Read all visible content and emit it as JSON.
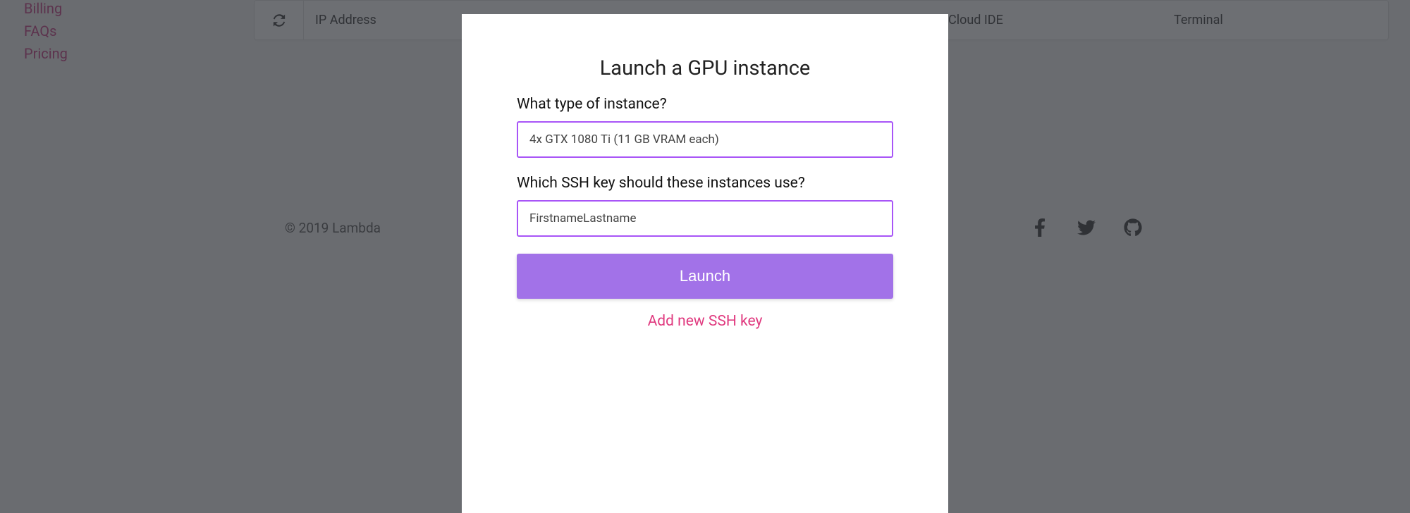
{
  "sidebar": {
    "links": [
      "Billing",
      "FAQs",
      "Pricing"
    ]
  },
  "table": {
    "headers": {
      "ip": "IP Address",
      "ide": "Cloud IDE",
      "terminal": "Terminal"
    }
  },
  "footer": {
    "copyright": "© 2019 Lambda"
  },
  "modal": {
    "title": "Launch a GPU instance",
    "instance_label": "What type of instance?",
    "instance_value": "4x GTX 1080 Ti (11 GB VRAM each)",
    "ssh_label": "Which SSH key should these instances use?",
    "ssh_value": "FirstnameLastname",
    "launch_button": "Launch",
    "add_ssh_link": "Add new SSH key"
  }
}
